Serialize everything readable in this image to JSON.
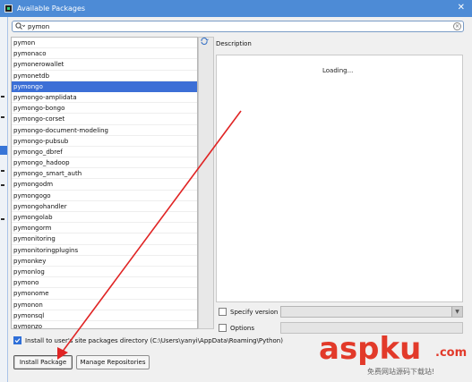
{
  "window": {
    "title": "Available Packages",
    "close_glyph": "✕"
  },
  "search": {
    "value": "pymon",
    "icon": "search-icon"
  },
  "packages": [
    {
      "name": "pymon",
      "selected": false
    },
    {
      "name": "pymonaco",
      "selected": false
    },
    {
      "name": "pymonerowallet",
      "selected": false
    },
    {
      "name": "pymonetdb",
      "selected": false
    },
    {
      "name": "pymongo",
      "selected": true
    },
    {
      "name": "pymongo-amplidata",
      "selected": false
    },
    {
      "name": "pymongo-bongo",
      "selected": false
    },
    {
      "name": "pymongo-corset",
      "selected": false
    },
    {
      "name": "pymongo-document-modeling",
      "selected": false
    },
    {
      "name": "pymongo-pubsub",
      "selected": false
    },
    {
      "name": "pymongo_dbref",
      "selected": false
    },
    {
      "name": "pymongo_hadoop",
      "selected": false
    },
    {
      "name": "pymongo_smart_auth",
      "selected": false
    },
    {
      "name": "pymongodm",
      "selected": false
    },
    {
      "name": "pymongogo",
      "selected": false
    },
    {
      "name": "pymongohandler",
      "selected": false
    },
    {
      "name": "pymongolab",
      "selected": false
    },
    {
      "name": "pymongorm",
      "selected": false
    },
    {
      "name": "pymonitoring",
      "selected": false
    },
    {
      "name": "pymonitoringplugins",
      "selected": false
    },
    {
      "name": "pymonkey",
      "selected": false
    },
    {
      "name": "pymonlog",
      "selected": false
    },
    {
      "name": "pymono",
      "selected": false
    },
    {
      "name": "pymonome",
      "selected": false
    },
    {
      "name": "pymonon",
      "selected": false
    },
    {
      "name": "pymonsql",
      "selected": false
    },
    {
      "name": "pymonzo",
      "selected": false
    }
  ],
  "description": {
    "label": "Description",
    "loading_text": "Loading..."
  },
  "specify_version": {
    "label": "Specify version",
    "checked": false
  },
  "options": {
    "label": "Options",
    "checked": false
  },
  "install_to_user": {
    "label": "Install to user's site packages directory (C:\\Users\\yanyi\\AppData\\Roaming\\Python)",
    "checked": true
  },
  "buttons": {
    "install": "Install Package",
    "manage": "Manage Repositories"
  },
  "watermark": {
    "brand": "aspku",
    "tld": ".com",
    "tagline": "免费网站源码下载站!"
  },
  "colors": {
    "titlebar": "#4d8bd6",
    "selection": "#3c6fd6",
    "annotation_arrow": "#e02424",
    "watermark": "#e23a2a"
  }
}
